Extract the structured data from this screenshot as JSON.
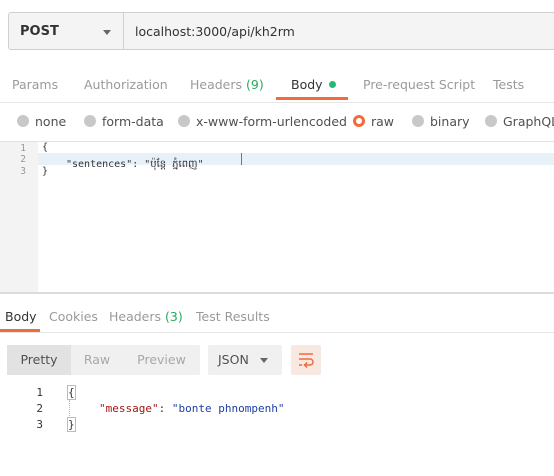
{
  "request": {
    "method": "POST",
    "url": "localhost:3000/api/kh2rm"
  },
  "request_tabs": [
    {
      "label": "Params"
    },
    {
      "label": "Authorization"
    },
    {
      "label": "Headers",
      "count": "(9)"
    },
    {
      "label": "Body"
    },
    {
      "label": "Pre-request Script"
    },
    {
      "label": "Tests"
    }
  ],
  "body_types": [
    {
      "label": "none",
      "selected": false
    },
    {
      "label": "form-data",
      "selected": false
    },
    {
      "label": "x-www-form-urlencoded",
      "selected": false
    },
    {
      "label": "raw",
      "selected": true
    },
    {
      "label": "binary",
      "selected": false
    },
    {
      "label": "GraphQL",
      "selected": false
    }
  ],
  "request_editor": {
    "line_numbers": [
      "1",
      "2",
      "3"
    ],
    "lines": [
      "{",
      "\"sentences\": \"ប៉ុន្តែ ភ្នំពេញ\"",
      "}"
    ]
  },
  "response_tabs": [
    {
      "label": "Body"
    },
    {
      "label": "Cookies"
    },
    {
      "label": "Headers",
      "count": "(3)"
    },
    {
      "label": "Test Results"
    }
  ],
  "response_toolbar": {
    "pretty": "Pretty",
    "raw": "Raw",
    "preview": "Preview",
    "format": "JSON"
  },
  "response_editor": {
    "line_numbers": [
      "1",
      "2",
      "3"
    ],
    "open_brace": "{",
    "key": "\"message\"",
    "colon": ": ",
    "value": "\"bonte phnompenh\"",
    "close_brace": "}"
  },
  "colors": {
    "accent": "#f26b3a",
    "success": "#2bb673",
    "json_key": "#a31515",
    "json_string": "#1c3fa8"
  }
}
